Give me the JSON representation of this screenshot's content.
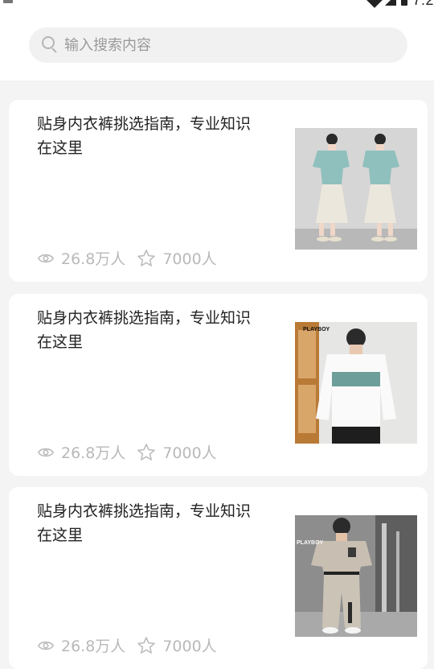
{
  "status_bar": {
    "time": "7:2"
  },
  "search": {
    "placeholder": "输入搜索内容",
    "value": ""
  },
  "articles": [
    {
      "title": "贴身内衣裤挑选指南，专业知识在这里",
      "views": "26.8万人",
      "likes": "7000人",
      "thumbnail": "model-mirrored-dresses-image"
    },
    {
      "title": "贴身内衣裤挑选指南，专业知识在这里",
      "views": "26.8万人",
      "likes": "7000人",
      "thumbnail": "white-sweatshirt-image",
      "brand_text": "PLAYBOY"
    },
    {
      "title": "贴身内衣裤挑选指南，专业知识在这里",
      "views": "26.8万人",
      "likes": "7000人",
      "thumbnail": "beige-tracksuit-image",
      "brand_text": "PLAYBOY"
    }
  ],
  "icons": {
    "views": "eye-icon",
    "likes": "star-icon",
    "search": "search-icon"
  }
}
